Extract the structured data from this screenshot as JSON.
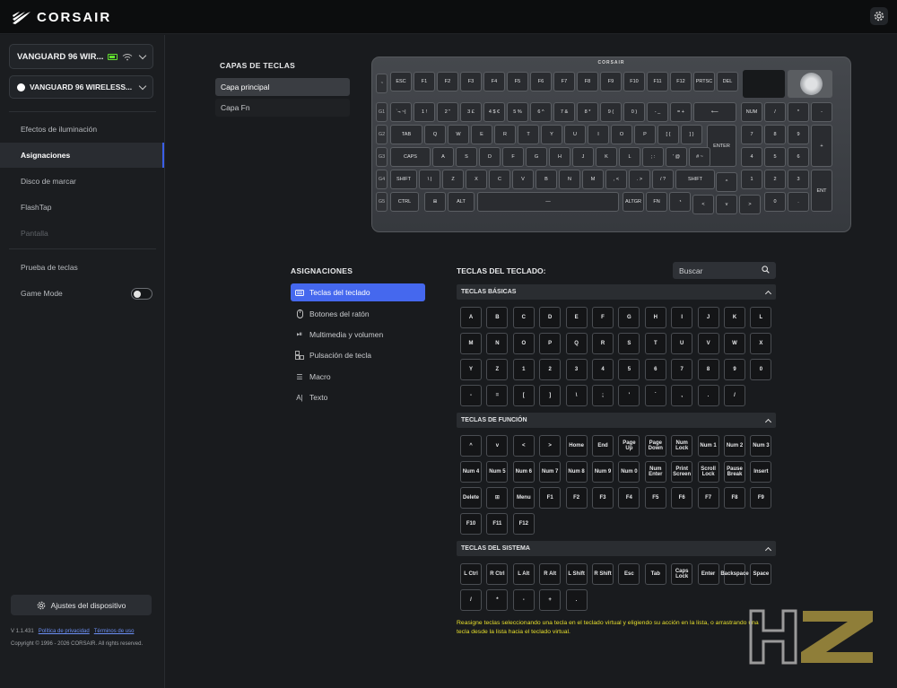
{
  "app": {
    "brand": "CORSAIR",
    "settings_icon": "gear-icon"
  },
  "sidebar": {
    "device_primary": "VANGUARD 96 WIR...",
    "device_secondary": "VANGUARD 96 WIRELESS...",
    "nav": [
      {
        "label": "Efectos de iluminación",
        "state": "normal"
      },
      {
        "label": "Asignaciones",
        "state": "active"
      },
      {
        "label": "Disco de marcar",
        "state": "normal"
      },
      {
        "label": "FlashTap",
        "state": "normal"
      },
      {
        "label": "Pantalla",
        "state": "disabled"
      }
    ],
    "key_test": "Prueba de teclas",
    "game_mode": "Game Mode",
    "game_mode_on": false,
    "settings_button": "Ajustes del dispositivo",
    "version": "V 1.1.431",
    "privacy": "Política de privacidad",
    "terms": "Términos de uso",
    "copyright": "Copyright © 1996 - 2026 CORSAIR. All rights reserved."
  },
  "layers": {
    "title": "CAPAS DE TECLAS",
    "items": [
      "Capa principal",
      "Capa Fn"
    ],
    "active": 0
  },
  "keyboard": {
    "brand": "CORSAIR",
    "macro_keys": [
      "G1",
      "G2",
      "G3",
      "G4",
      "G5"
    ],
    "row_fn": [
      "ESC",
      "F1",
      "F2",
      "F3",
      "F4",
      "F5",
      "F6",
      "F7",
      "F8",
      "F9",
      "F10",
      "F11",
      "F12",
      "PRTSC",
      "DEL"
    ],
    "row_num": [
      "`¬ ~|",
      "1 !",
      "2 \"",
      "3 £",
      "4 $ €",
      "5 %",
      "6 ^",
      "7 &",
      "8 *",
      "9 (",
      "0 )",
      "- _",
      "= +",
      "⟵",
      "NUM",
      "/",
      "*",
      "-"
    ],
    "row_tab": [
      "TAB",
      "Q",
      "W",
      "E",
      "R",
      "T",
      "Y",
      "U",
      "I",
      "O",
      "P",
      "[ {",
      "] }",
      "ENTER",
      "7",
      "8",
      "9",
      "+"
    ],
    "row_caps": [
      "CAPS",
      "A",
      "S",
      "D",
      "F",
      "G",
      "H",
      "J",
      "K",
      "L",
      ";  :",
      "' @",
      "# ~",
      "4",
      "5",
      "6"
    ],
    "row_shift": [
      "SHIFT",
      "\\ |",
      "Z",
      "X",
      "C",
      "V",
      "B",
      "N",
      "M",
      ", <",
      ". >",
      "/ ?",
      "SHIFT",
      "^",
      "1",
      "2",
      "3",
      "ENT"
    ],
    "row_ctrl": [
      "CTRL",
      "⊞",
      "ALT",
      "—",
      "ALTGR",
      "FN",
      "◔",
      "<",
      "v",
      ">",
      "0",
      "."
    ]
  },
  "assignments": {
    "title": "ASIGNACIONES",
    "menu": [
      {
        "label": "Teclas del teclado",
        "icon": "keyboard-icon"
      },
      {
        "label": "Botones del ratón",
        "icon": "mouse-icon"
      },
      {
        "label": "Multimedia y volumen",
        "icon": "play-pause-icon"
      },
      {
        "label": "Pulsación de tecla",
        "icon": "keystroke-icon"
      },
      {
        "label": "Macro",
        "icon": "list-icon"
      },
      {
        "label": "Texto",
        "icon": "text-icon"
      }
    ],
    "active": 0
  },
  "keys": {
    "title": "TECLAS DEL TECLADO:",
    "search_placeholder": "Buscar",
    "categories": [
      {
        "title": "TECLAS BÁSICAS",
        "keys": [
          "A",
          "B",
          "C",
          "D",
          "E",
          "F",
          "G",
          "H",
          "I",
          "J",
          "K",
          "L",
          "M",
          "N",
          "O",
          "P",
          "Q",
          "R",
          "S",
          "T",
          "U",
          "V",
          "W",
          "X",
          "Y",
          "Z",
          "1",
          "2",
          "3",
          "4",
          "5",
          "6",
          "7",
          "8",
          "9",
          "0",
          "-",
          "=",
          "[",
          "]",
          "\\",
          ";",
          "'",
          "`",
          ",",
          ".",
          "/"
        ]
      },
      {
        "title": "TECLAS DE FUNCIÓN",
        "keys": [
          "^",
          "v",
          "<",
          ">",
          "Home",
          "End",
          "Page Up",
          "Page Down",
          "Num Lock",
          "Num 1",
          "Num 2",
          "Num 3",
          "Num 4",
          "Num 5",
          "Num 6",
          "Num 7",
          "Num 8",
          "Num 9",
          "Num 0",
          "Num Enter",
          "Print Screen",
          "Scroll Lock",
          "Pause Break",
          "Insert",
          "Delete",
          "⊞",
          "Menu",
          "F1",
          "F2",
          "F3",
          "F4",
          "F5",
          "F6",
          "F7",
          "F8",
          "F9",
          "F10",
          "F11",
          "F12"
        ]
      },
      {
        "title": "TECLAS DEL SISTEMA",
        "keys": [
          "L Ctrl",
          "R Ctrl",
          "L Alt",
          "R Alt",
          "L Shift",
          "R Shift",
          "Esc",
          "Tab",
          "Caps Lock",
          "Enter",
          "Backspace",
          "Space",
          "/",
          "*",
          "-",
          "+",
          "."
        ]
      }
    ],
    "hint": "Reasigne teclas seleccionando una tecla en el teclado virtual y eligiendo su acción en la lista, o arrastrando una tecla desde la lista hacia el teclado virtual."
  },
  "watermark": "HZ",
  "colors": {
    "accent": "#4568ee",
    "battery": "#62e22e",
    "hint": "#e7df2c"
  }
}
